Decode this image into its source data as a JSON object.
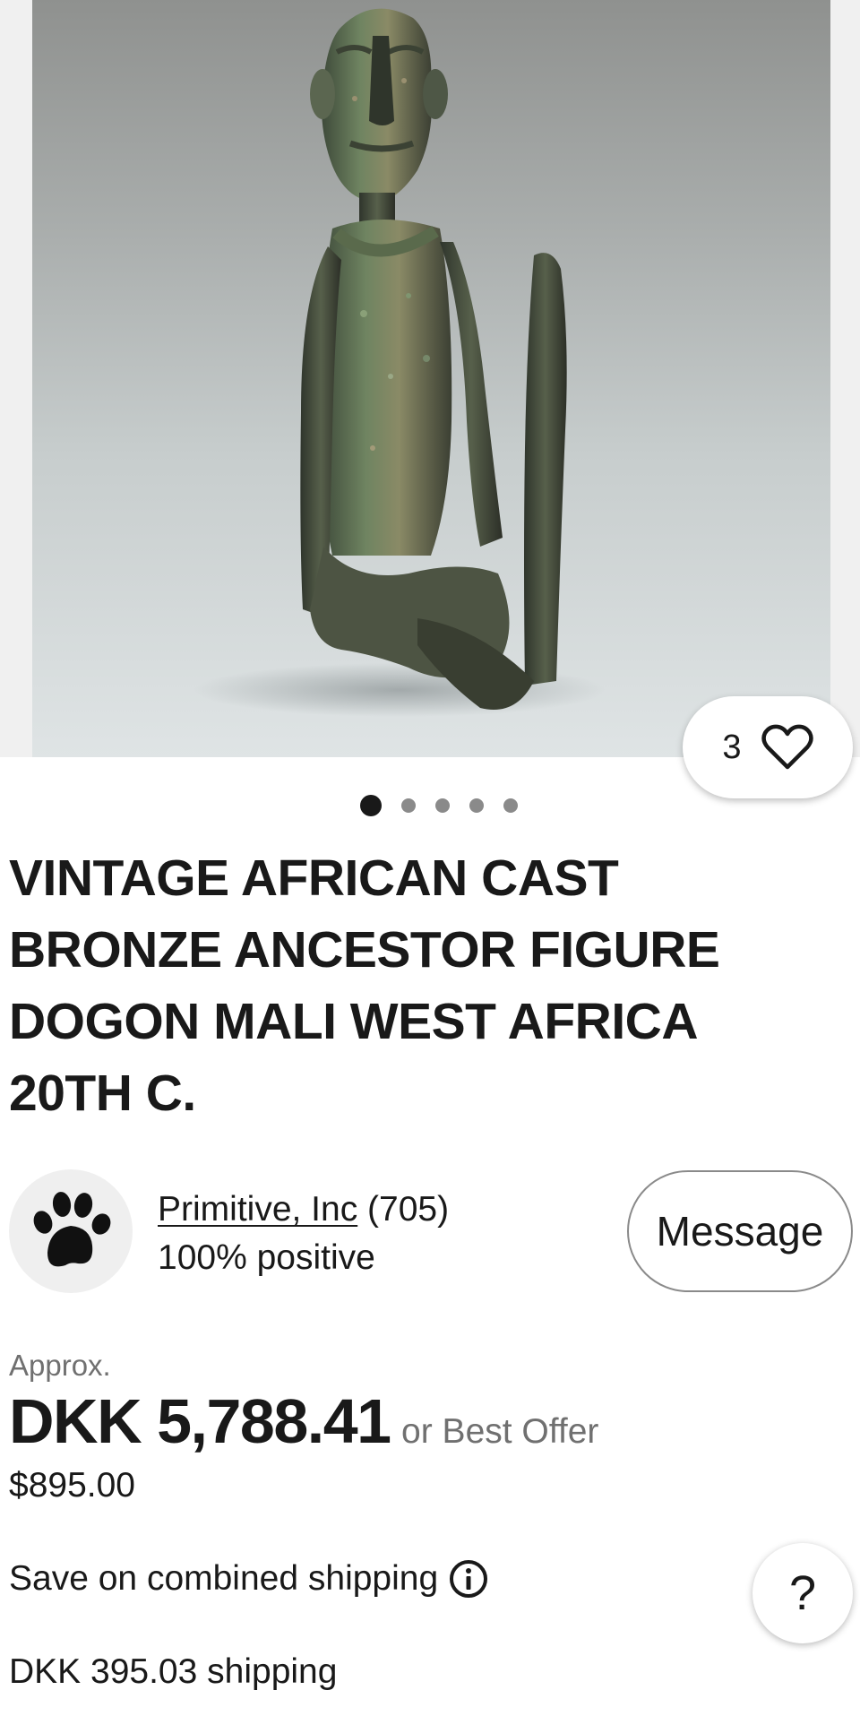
{
  "listing": {
    "image_count": 5,
    "active_image_index": 1,
    "watch_count": "3",
    "title": "VINTAGE AFRICAN CAST BRONZE ANCESTOR FIGURE DOGON MALI WEST AFRICA 20TH C."
  },
  "seller": {
    "avatar_icon": "paw-print-icon",
    "name": "Primitive, Inc",
    "feedback_count": "(705)",
    "feedback_percent": "100% positive",
    "message_label": "Message"
  },
  "price": {
    "approx_label": "Approx.",
    "main": "DKK 5,788.41",
    "suffix": "or Best Offer",
    "original": "$895.00"
  },
  "shipping": {
    "combined_label": "Save on combined shipping",
    "info_icon": "info-icon",
    "cost": "DKK 395.03 shipping"
  },
  "help": {
    "label": "?"
  },
  "colors": {
    "text": "#191919",
    "muted": "#707070",
    "border": "#8a8a8a"
  }
}
